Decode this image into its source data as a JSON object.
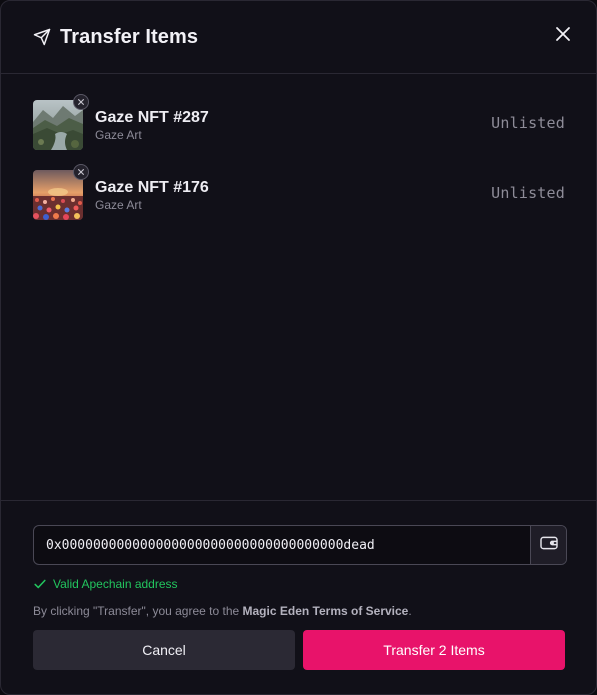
{
  "header": {
    "title": "Transfer Items",
    "icon": "send-icon",
    "close_icon": "close-icon"
  },
  "items": [
    {
      "name": "Gaze NFT #287",
      "collection": "Gaze Art",
      "status": "Unlisted",
      "thumbnail": "mountain-stream-landscape",
      "remove_icon": "close-icon"
    },
    {
      "name": "Gaze NFT #176",
      "collection": "Gaze Art",
      "status": "Unlisted",
      "thumbnail": "flower-field-sunset",
      "remove_icon": "close-icon"
    }
  ],
  "footer": {
    "address_value": "0x000000000000000000000000000000000000dead",
    "wallet_icon": "wallet-icon",
    "validation_icon": "check-icon",
    "validation_text": "Valid Apechain address",
    "terms_prefix": "By clicking \"Transfer\", you agree to the ",
    "terms_link": "Magic Eden Terms of Service",
    "terms_suffix": ".",
    "cancel_label": "Cancel",
    "transfer_label": "Transfer 2 Items"
  },
  "colors": {
    "accent": "#e8136a",
    "success": "#22c55e",
    "background": "#111018"
  }
}
